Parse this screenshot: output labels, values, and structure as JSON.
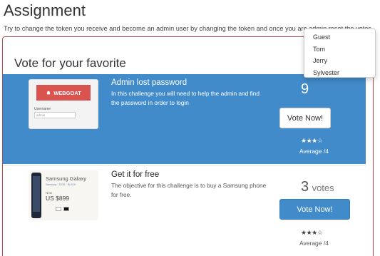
{
  "page": {
    "title": "Assignment",
    "instructions": "Try to change the token you receive and become an admin user by changing the token and once you are admin reset the votes"
  },
  "panel": {
    "heading": "Vote for your favorite",
    "toolbar": {
      "user_icon": "user-icon",
      "refresh_icon": "refresh-icon",
      "trash_icon": "trash-icon"
    },
    "user_menu": [
      "Guest",
      "Tom",
      "Jerry",
      "Sylvester"
    ]
  },
  "challenges": [
    {
      "title": "Admin lost password",
      "description": "In this challenge you will need to help the admin and find the password in order to login",
      "votes_partial": "9",
      "vote_button": "Vote Now!",
      "stars": "★★★☆",
      "rating": 3.5,
      "average_label": "Average /4",
      "thumbnail": {
        "brand": "WEBGOAT",
        "field_label": "Username",
        "field_value": "admin"
      }
    },
    {
      "title": "Get it for free",
      "description": "The objective for this challenge is to buy a Samsung phone for free.",
      "votes": "3",
      "votes_word": "votes",
      "vote_button": "Vote Now!",
      "stars": "★★★☆",
      "rating": 3,
      "average_label": "Average /4",
      "thumbnail": {
        "product": "Samsung Galaxy",
        "subtitle": "Samsung · 32GB · BLACK",
        "now_label": "Now",
        "price": "US $899"
      }
    }
  ],
  "colors": {
    "accent": "#428bca",
    "panel_border": "#b24a4a",
    "webgoat_red": "#d9534f"
  }
}
